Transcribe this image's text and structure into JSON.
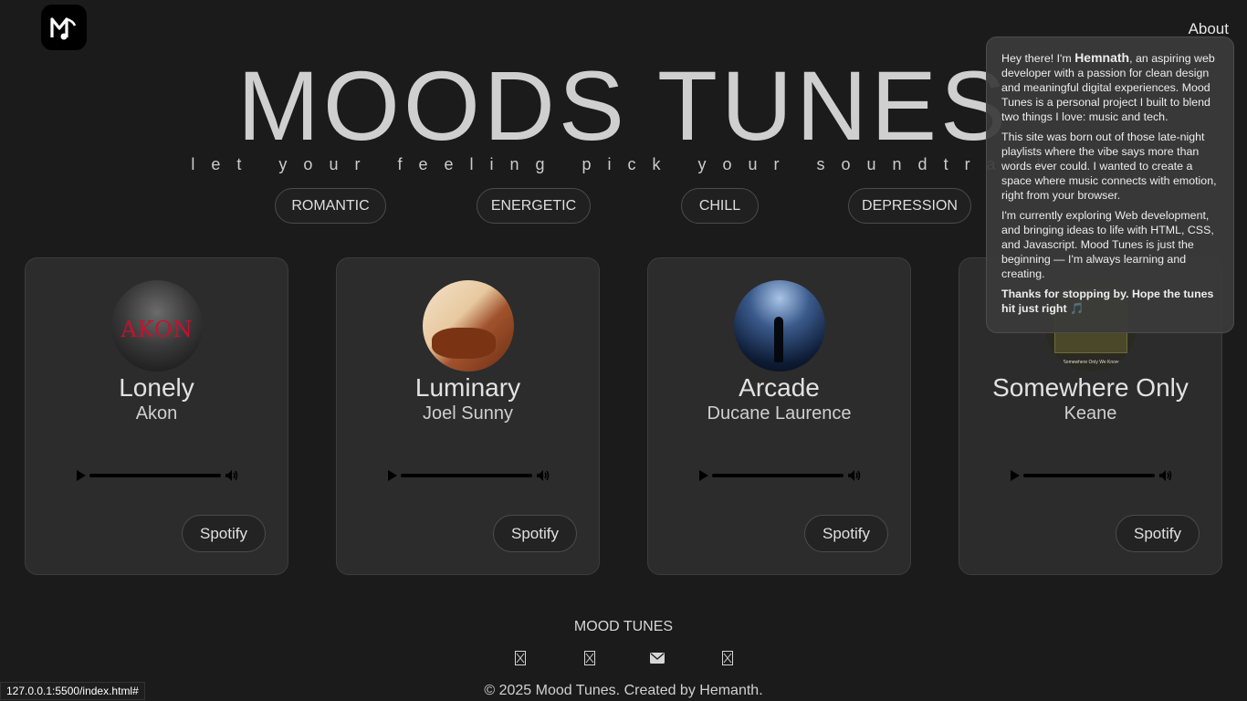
{
  "header": {
    "about_label": "About"
  },
  "hero": {
    "title": "MOODS TUNES",
    "tagline": "let your feeling pick your soundtrack"
  },
  "moods": [
    {
      "label": "ROMANTIC"
    },
    {
      "label": "ENERGETIC"
    },
    {
      "label": "CHILL"
    },
    {
      "label": "DEPRESSION"
    }
  ],
  "songs": [
    {
      "title": "Lonely",
      "artist": "Akon",
      "spotify_label": "Spotify",
      "cover_text": "AKON"
    },
    {
      "title": "Luminary",
      "artist": "Joel Sunny",
      "spotify_label": "Spotify"
    },
    {
      "title": "Arcade",
      "artist": "Ducane Laurence",
      "spotify_label": "Spotify"
    },
    {
      "title": "Somewhere Only",
      "artist": "Keane",
      "spotify_label": "Spotify",
      "cover_text": "Somewhere Only We Know"
    }
  ],
  "about_popup": {
    "p1_pre": "Hey there! I'm ",
    "p1_name": "Hemnath",
    "p1_post": ", an aspiring web developer with a passion for clean design and meaningful digital experiences. Mood Tunes is a personal project I built to blend two things I love: music and tech.",
    "p2": "This site was born out of those late-night playlists where the vibe says more than words ever could. I wanted to create a space where music connects with emotion, right from your browser.",
    "p3": "I'm currently exploring Web development, and bringing ideas to life with HTML, CSS, and Javascript. Mood Tunes is just the beginning — I'm always learning and creating.",
    "p4": "Thanks for stopping by. Hope the tunes hit just right 🎵"
  },
  "footer": {
    "brand": "MOOD TUNES",
    "social_icons": [
      "missing-glyph-icon",
      "missing-glyph-icon",
      "envelope-icon",
      "missing-glyph-icon"
    ],
    "copyright": "© 2025 Mood Tunes. Created by Hemanth."
  },
  "status_bar": {
    "url": "127.0.0.1:5500/index.html#"
  },
  "colors": {
    "background": "#1b1b1b",
    "card": "#2c2c2c",
    "popup": "#3a3a3a"
  }
}
